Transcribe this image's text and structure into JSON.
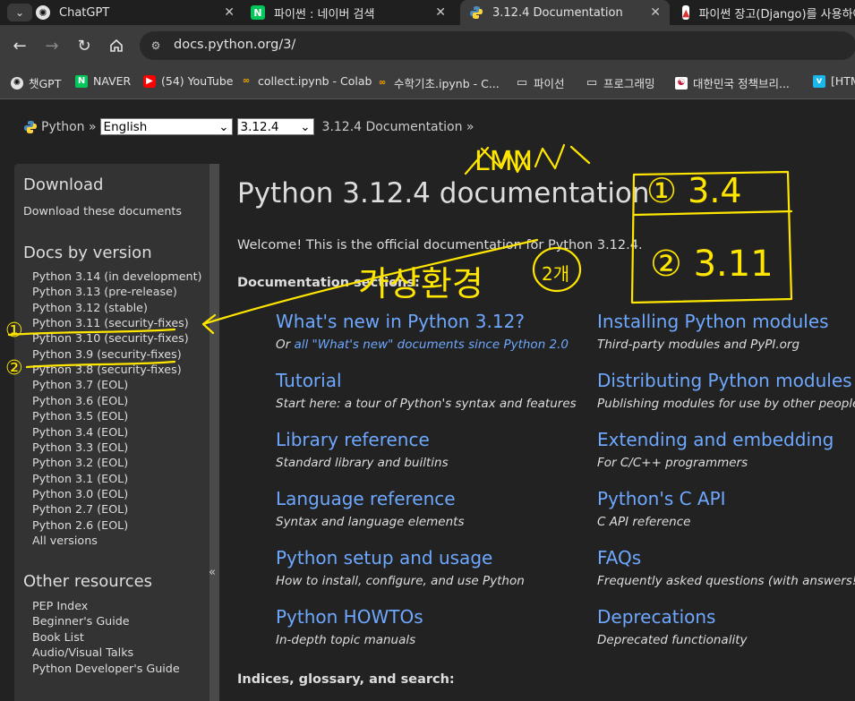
{
  "tabs": [
    {
      "title": "ChatGPT",
      "close": "✕"
    },
    {
      "title": "파이썬 : 네이버 검색",
      "close": "✕"
    },
    {
      "title": "3.12.4 Documentation",
      "close": "✕"
    },
    {
      "title": "파이썬 장고(Django)를 사용하여"
    }
  ],
  "address": {
    "url": "docs.python.org/3/"
  },
  "bookmarks": [
    "챗GPT",
    "NAVER",
    "(54) YouTube",
    "collect.ipynb - Colab",
    "수학기초.ipynb - C...",
    "파이선",
    "프로그래밍",
    "대한민국 정책브리...",
    "[HTM"
  ],
  "breadcrumb": {
    "python": "Python »",
    "language": "English",
    "version": "3.12.4",
    "current": "3.12.4 Documentation »"
  },
  "sidebar": {
    "download_title": "Download",
    "download_link": "Download these documents",
    "versions_title": "Docs by version",
    "versions": [
      "Python 3.14 (in development)",
      "Python 3.13 (pre-release)",
      "Python 3.12 (stable)",
      "Python 3.11 (security-fixes)",
      "Python 3.10 (security-fixes)",
      "Python 3.9 (security-fixes)",
      "Python 3.8 (security-fixes)",
      "Python 3.7 (EOL)",
      "Python 3.6 (EOL)",
      "Python 3.5 (EOL)",
      "Python 3.4 (EOL)",
      "Python 3.3 (EOL)",
      "Python 3.2 (EOL)",
      "Python 3.1 (EOL)",
      "Python 3.0 (EOL)",
      "Python 2.7 (EOL)",
      "Python 2.6 (EOL)",
      "All versions"
    ],
    "other_title": "Other resources",
    "other": [
      "PEP Index",
      "Beginner's Guide",
      "Book List",
      "Audio/Visual Talks",
      "Python Developer's Guide"
    ],
    "collapse": "«"
  },
  "main": {
    "title": "Python 3.12.4 documentation",
    "welcome": "Welcome! This is the official documentation for Python 3.12.4.",
    "sections_label": "Documentation sections:",
    "left": [
      {
        "title": "What's new in Python 3.12?",
        "desc_pre": "Or ",
        "desc_link": "all \"What's new\" documents since Python 2.0"
      },
      {
        "title": "Tutorial",
        "desc": "Start here: a tour of Python's syntax and features"
      },
      {
        "title": "Library reference",
        "desc": "Standard library and builtins"
      },
      {
        "title": "Language reference",
        "desc": "Syntax and language elements"
      },
      {
        "title": "Python setup and usage",
        "desc": "How to install, configure, and use Python"
      },
      {
        "title": "Python HOWTOs",
        "desc": "In-depth topic manuals"
      }
    ],
    "right": [
      {
        "title": "Installing Python modules",
        "desc": "Third-party modules and PyPI.org"
      },
      {
        "title": "Distributing Python modules",
        "desc": "Publishing modules for use by other people"
      },
      {
        "title": "Extending and embedding",
        "desc": "For C/C++ programmers"
      },
      {
        "title": "Python's C API",
        "desc": "C API reference"
      },
      {
        "title": "FAQs",
        "desc": "Frequently asked questions (with answers!)"
      },
      {
        "title": "Deprecations",
        "desc": "Deprecated functionality"
      }
    ],
    "indices_label": "Indices, glossary, and search:"
  },
  "annotations": {
    "top_scribble": "LMN",
    "korean_note": "가상환경",
    "circled_note": "2개",
    "box_row1": "① 3.4",
    "box_row2": "② 3.11",
    "side_mark1": "①",
    "side_mark2": "②",
    "color": "#ffe600"
  }
}
